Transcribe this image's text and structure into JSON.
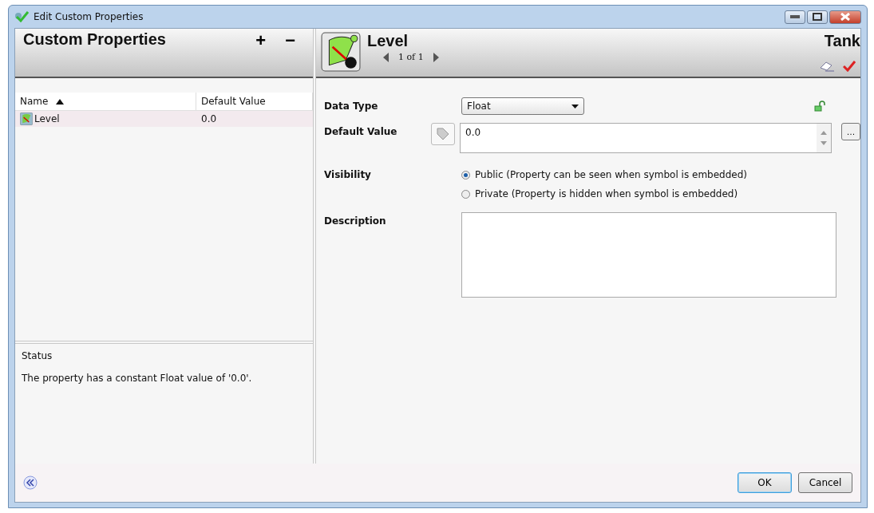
{
  "window": {
    "title": "Edit Custom Properties"
  },
  "left_panel": {
    "title": "Custom Properties",
    "add_button": "+",
    "remove_button": "−",
    "columns": [
      {
        "label": "Name",
        "sorted": true
      },
      {
        "label": "Default Value",
        "sorted": false
      }
    ],
    "rows": [
      {
        "name": "Level",
        "default_value": "0.0",
        "selected": true
      }
    ],
    "status": {
      "title": "Status",
      "message": "The property has a constant Float value of '0.0'."
    }
  },
  "right_panel": {
    "title": "Level",
    "pager": "1 of 1",
    "symbol": "Tank",
    "data_type": {
      "label": "Data Type",
      "value": "Float"
    },
    "default_value": {
      "label": "Default Value",
      "value": "0.0",
      "browse_button": "…"
    },
    "visibility": {
      "label": "Visibility",
      "options": [
        {
          "label": "Public (Property can be seen when symbol is embedded)",
          "selected": true
        },
        {
          "label": "Private (Property is hidden when symbol is embedded)",
          "selected": false
        }
      ]
    },
    "description": {
      "label": "Description"
    }
  },
  "buttons": [
    {
      "label": "OK",
      "default": true
    },
    {
      "label": "Cancel",
      "default": false
    }
  ]
}
